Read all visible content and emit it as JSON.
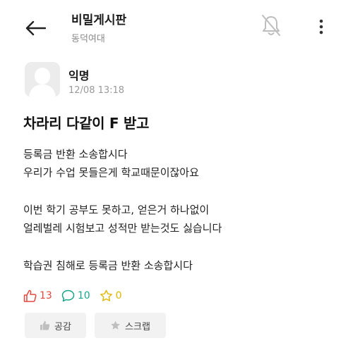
{
  "header": {
    "title": "비밀게시판",
    "subtitle": "동덕여대",
    "back_icon": "arrow-left-icon",
    "bell_icon": "bell-off-icon",
    "more_icon": "more-vertical-icon"
  },
  "post": {
    "author": "익명",
    "time": "12/08 13:18",
    "title": "차라리 다같이 F 받고",
    "body": {
      "p1": [
        "등록금 반환 소송합시다",
        "우리가 수업 못들은게 학교때문이잖아요"
      ],
      "p2": [
        "이번 학기 공부도 못하고, 얻은거 하나없이",
        "얼레벌레 시험보고 성적만 받는것도 싫습니다"
      ],
      "p3": [
        "학습권 침해로 등록금 반환 소송합시다"
      ]
    }
  },
  "reactions": {
    "likes": "13",
    "comments": "10",
    "scraps": "0",
    "colors": {
      "like": "#e0493f",
      "comment": "#17a589",
      "scrap": "#e0b600"
    }
  },
  "actions": {
    "empathy_label": "공감",
    "scrap_label": "스크랩"
  }
}
